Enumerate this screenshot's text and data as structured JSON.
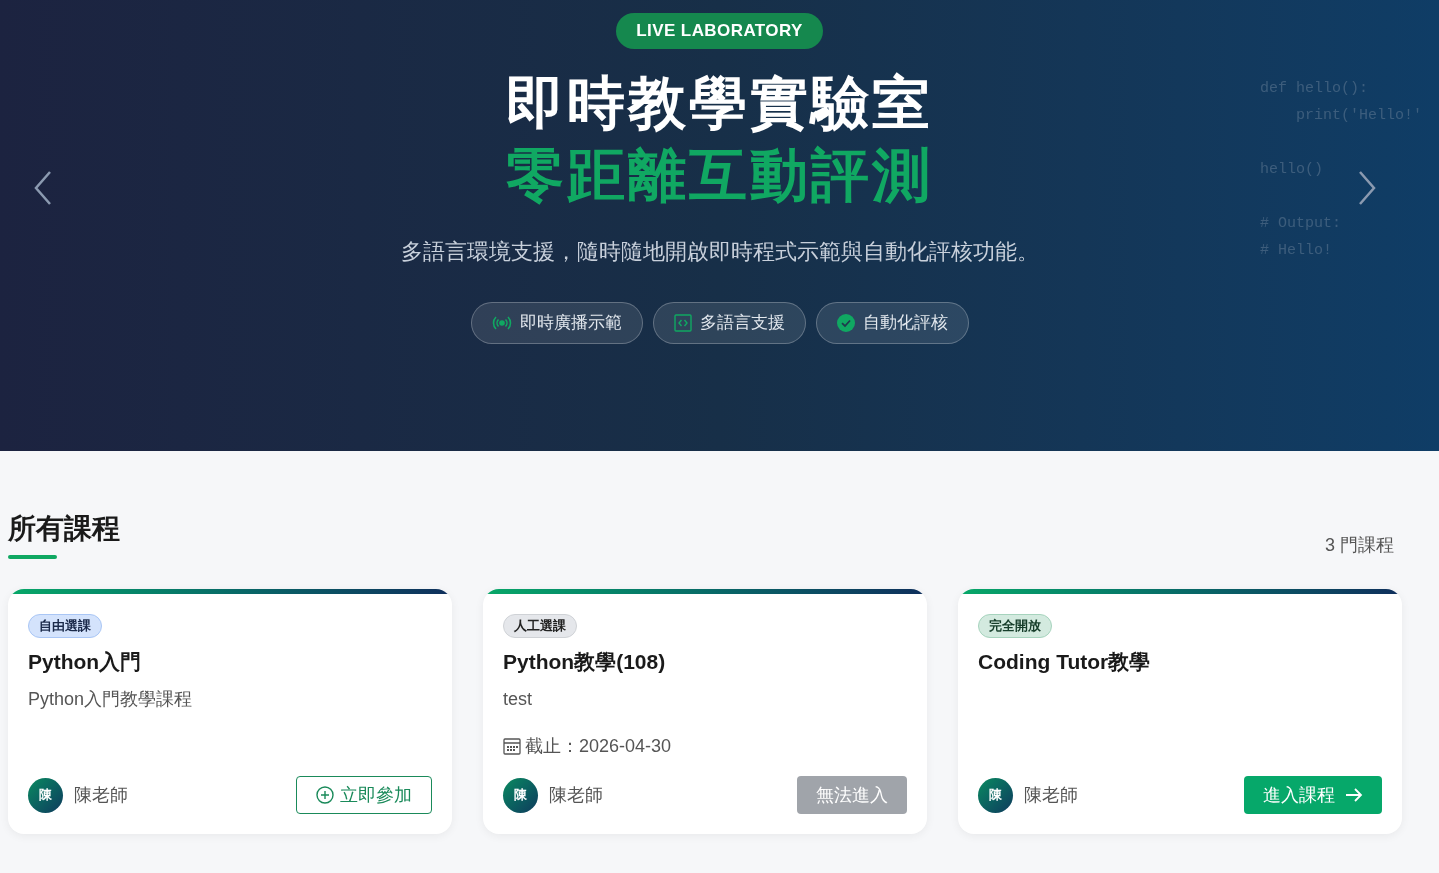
{
  "hero": {
    "badge": "LIVE LABORATORY",
    "title": "即時教學實驗室",
    "subtitle": "零距離互動評測",
    "description": "多語言環境支援，隨時隨地開啟即時程式示範與自動化評核功能。",
    "features": [
      {
        "kind": "broadcast",
        "label": "即時廣播示範"
      },
      {
        "kind": "code",
        "label": "多語言支援"
      },
      {
        "kind": "check",
        "label": "自動化評核"
      }
    ],
    "code_blocks": [
      [
        "def hello():",
        "    print('Hello!'"
      ],
      [
        "hello()"
      ],
      [
        "# Output:",
        "# Hello!"
      ]
    ]
  },
  "section": {
    "title": "所有課程",
    "count": "3 門課程"
  },
  "courses": [
    {
      "tag": {
        "kind": "free",
        "label": "自由選課"
      },
      "title": "Python入門",
      "description": "Python入門教學課程",
      "teacher_initial": "陳",
      "teacher": "陳老師",
      "action": {
        "kind": "join",
        "label": "立即參加",
        "disabled": false
      }
    },
    {
      "tag": {
        "kind": "manual",
        "label": "人工選課"
      },
      "title": "Python教學(108)",
      "description": "test",
      "deadline": "截止：2026-04-30",
      "teacher_initial": "陳",
      "teacher": "陳老師",
      "action": {
        "kind": "blocked",
        "label": "無法進入",
        "disabled": true
      }
    },
    {
      "tag": {
        "kind": "open",
        "label": "完全開放"
      },
      "title": "Coding Tutor教學",
      "teacher_initial": "陳",
      "teacher": "陳老師",
      "action": {
        "kind": "enter",
        "label": "進入課程",
        "disabled": false
      }
    }
  ]
}
